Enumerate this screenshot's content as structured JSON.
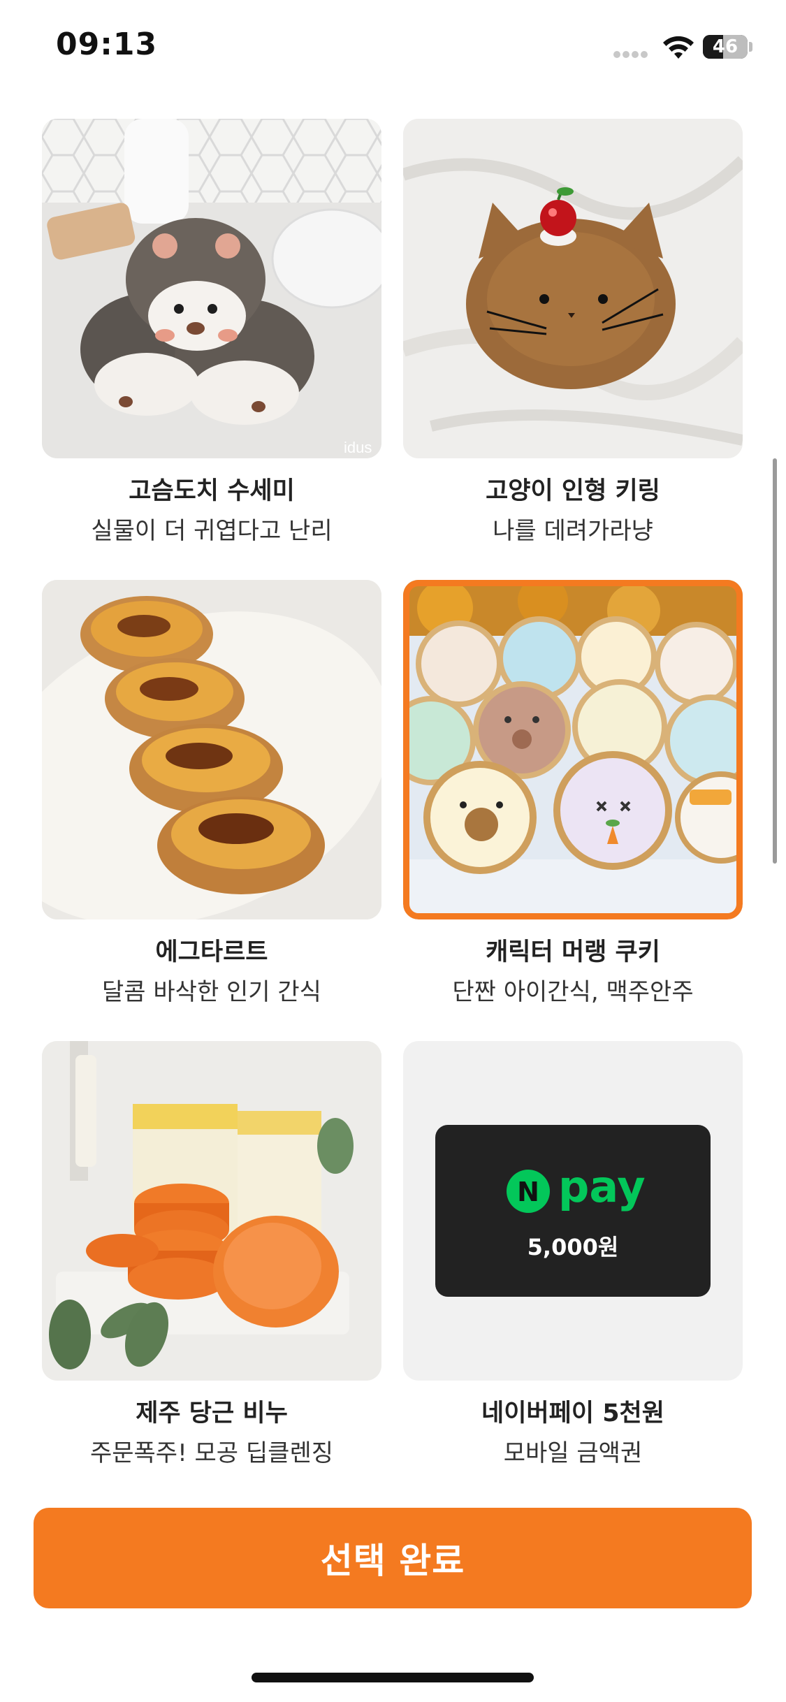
{
  "status_bar": {
    "time": "09:13",
    "battery_level": 46,
    "battery_label": "46"
  },
  "products": [
    {
      "title": "고슴도치 수세미",
      "subtitle": "실물이 더 귀엽다고 난리",
      "watermark": "idus",
      "image": "hedgehog-scrubbers-photo",
      "selected": false
    },
    {
      "title": "고양이 인형 키링",
      "subtitle": "나를 데려가라냥",
      "image": "cat-plush-keyring-photo",
      "selected": false
    },
    {
      "title": "에그타르트",
      "subtitle": "달콤 바삭한 인기 간식",
      "image": "egg-tarts-photo",
      "selected": false
    },
    {
      "title": "캐릭터 머랭 쿠키",
      "subtitle": "단짠 아이간식, 맥주안주",
      "image": "character-meringue-cookies-photo",
      "selected": true
    },
    {
      "title": "제주 당근 비누",
      "subtitle": "주문폭주! 모공 딥클렌징",
      "image": "jeju-carrot-soap-photo",
      "selected": false
    },
    {
      "title": "네이버페이 5천원",
      "subtitle": "모바일 금액권",
      "image": "npay-voucher",
      "voucher": {
        "logo_letter": "N",
        "logo_text": "pay",
        "amount": "5,000원"
      },
      "selected": false
    }
  ],
  "done_button": {
    "label": "선택 완료"
  },
  "colors": {
    "accent": "#f47a20",
    "npay_green": "#03c75a",
    "voucher_bg": "#222222"
  }
}
